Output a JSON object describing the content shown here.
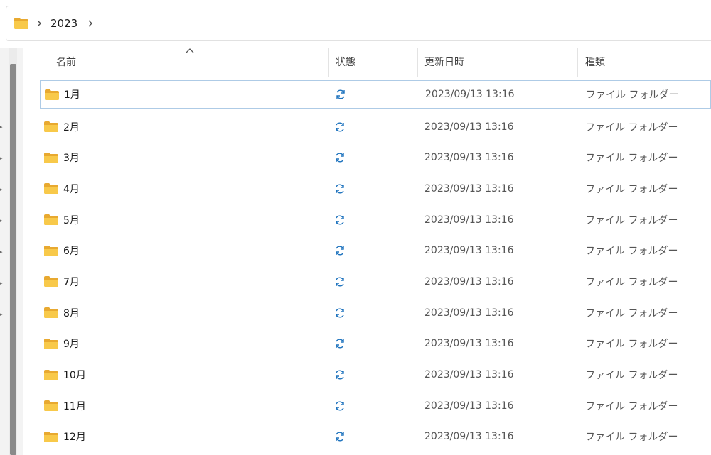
{
  "addressbar": {
    "folder": "2023"
  },
  "columns": {
    "name": "名前",
    "status": "状態",
    "modified": "更新日時",
    "type": "種類"
  },
  "rows": [
    {
      "name": "1月",
      "modified": "2023/09/13 13:16",
      "type": "ファイル フォルダー",
      "status_icon": "sync-icon"
    },
    {
      "name": "2月",
      "modified": "2023/09/13 13:16",
      "type": "ファイル フォルダー",
      "status_icon": "sync-icon"
    },
    {
      "name": "3月",
      "modified": "2023/09/13 13:16",
      "type": "ファイル フォルダー",
      "status_icon": "sync-icon"
    },
    {
      "name": "4月",
      "modified": "2023/09/13 13:16",
      "type": "ファイル フォルダー",
      "status_icon": "sync-icon"
    },
    {
      "name": "5月",
      "modified": "2023/09/13 13:16",
      "type": "ファイル フォルダー",
      "status_icon": "sync-icon"
    },
    {
      "name": "6月",
      "modified": "2023/09/13 13:16",
      "type": "ファイル フォルダー",
      "status_icon": "sync-icon"
    },
    {
      "name": "7月",
      "modified": "2023/09/13 13:16",
      "type": "ファイル フォルダー",
      "status_icon": "sync-icon"
    },
    {
      "name": "8月",
      "modified": "2023/09/13 13:16",
      "type": "ファイル フォルダー",
      "status_icon": "sync-icon"
    },
    {
      "name": "9月",
      "modified": "2023/09/13 13:16",
      "type": "ファイル フォルダー",
      "status_icon": "sync-icon"
    },
    {
      "name": "10月",
      "modified": "2023/09/13 13:16",
      "type": "ファイル フォルダー",
      "status_icon": "sync-icon"
    },
    {
      "name": "11月",
      "modified": "2023/09/13 13:16",
      "type": "ファイル フォルダー",
      "status_icon": "sync-icon"
    },
    {
      "name": "12月",
      "modified": "2023/09/13 13:16",
      "type": "ファイル フォルダー",
      "status_icon": "sync-icon"
    }
  ],
  "colors": {
    "folder_fill": "#f8c94a",
    "folder_tab": "#e8a930",
    "sync_blue": "#1e73be",
    "selection_border": "#aecbe6"
  }
}
